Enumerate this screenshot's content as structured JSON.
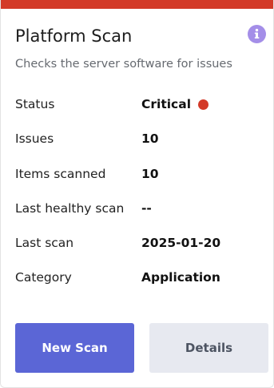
{
  "card": {
    "title": "Platform Scan",
    "subtitle": "Checks the server software for issues",
    "info_icon": "info-icon",
    "accent_color": "#d33a28"
  },
  "rows": [
    {
      "label": "Status",
      "value": "Critical",
      "status_color": "#d33a28"
    },
    {
      "label": "Issues",
      "value": "10"
    },
    {
      "label": "Items scanned",
      "value": "10"
    },
    {
      "label": "Last healthy scan",
      "value": "--"
    },
    {
      "label": "Last scan",
      "value": "2025-01-20"
    },
    {
      "label": "Category",
      "value": "Application"
    }
  ],
  "buttons": {
    "primary_label": "New Scan",
    "secondary_label": "Details",
    "primary_color": "#5b66d6",
    "secondary_color": "#e7e9f0"
  }
}
